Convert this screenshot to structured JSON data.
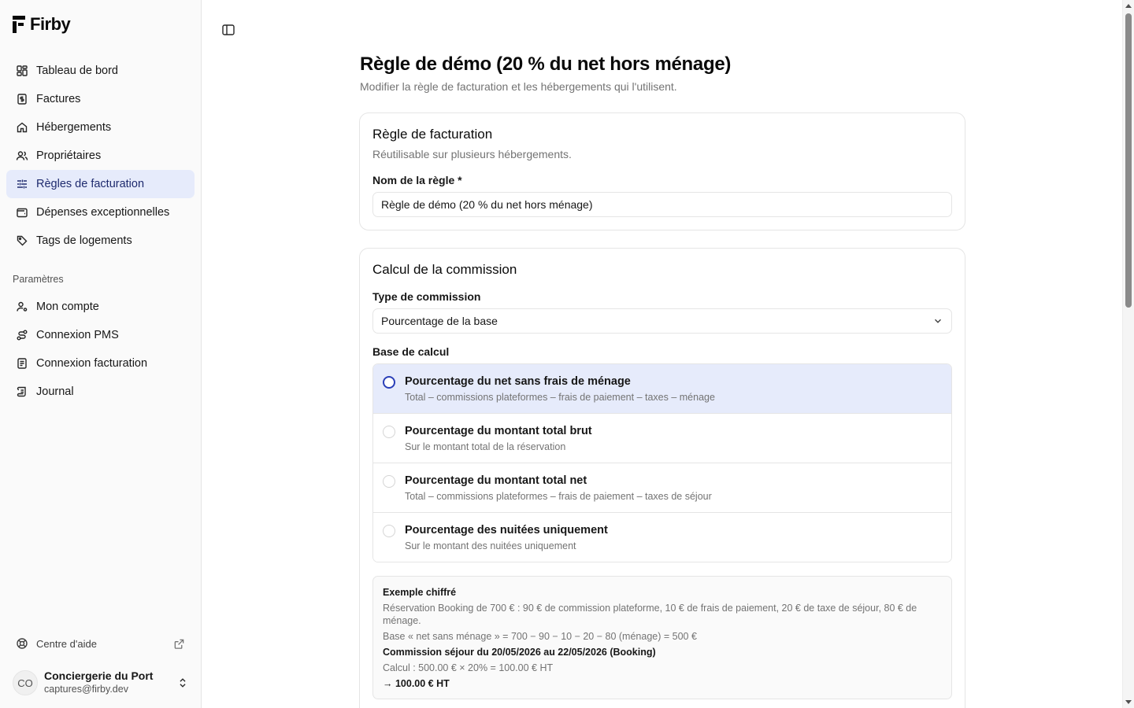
{
  "app": {
    "name": "Firby"
  },
  "sidebar": {
    "items": [
      {
        "label": "Tableau de bord",
        "icon": "dashboard-icon"
      },
      {
        "label": "Factures",
        "icon": "invoice-icon"
      },
      {
        "label": "Hébergements",
        "icon": "home-icon"
      },
      {
        "label": "Propriétaires",
        "icon": "users-icon"
      },
      {
        "label": "Règles de facturation",
        "icon": "sliders-icon",
        "active": true
      },
      {
        "label": "Dépenses exceptionnelles",
        "icon": "wallet-icon"
      },
      {
        "label": "Tags de logements",
        "icon": "tag-icon"
      }
    ],
    "settings_section": "Paramètres",
    "settings_items": [
      {
        "label": "Mon compte",
        "icon": "user-cog-icon"
      },
      {
        "label": "Connexion PMS",
        "icon": "route-icon"
      },
      {
        "label": "Connexion facturation",
        "icon": "file-text-icon"
      },
      {
        "label": "Journal",
        "icon": "scroll-icon"
      }
    ],
    "help": "Centre d'aide",
    "user": {
      "initials": "CO",
      "name": "Conciergerie du Port",
      "email": "captures@firby.dev"
    }
  },
  "page": {
    "title": "Règle de démo (20 % du net hors ménage)",
    "subtitle": "Modifier la règle de facturation et les hébergements qui l'utilisent."
  },
  "rule_card": {
    "title": "Règle de facturation",
    "description": "Réutilisable sur plusieurs hébergements.",
    "name_label": "Nom de la règle *",
    "name_value": "Règle de démo (20 % du net hors ménage)"
  },
  "commission_card": {
    "title": "Calcul de la commission",
    "type_label": "Type de commission",
    "type_value": "Pourcentage de la base",
    "base_label": "Base de calcul",
    "options": [
      {
        "title": "Pourcentage du net sans frais de ménage",
        "desc": "Total – commissions plateformes – frais de paiement – taxes – ménage",
        "selected": true
      },
      {
        "title": "Pourcentage du montant total brut",
        "desc": "Sur le montant total de la réservation",
        "selected": false
      },
      {
        "title": "Pourcentage du montant total net",
        "desc": "Total – commissions plateformes – frais de paiement – taxes de séjour",
        "selected": false
      },
      {
        "title": "Pourcentage des nuitées uniquement",
        "desc": "Sur le montant des nuitées uniquement",
        "selected": false
      }
    ],
    "example": {
      "title": "Exemple chiffré",
      "line1": "Réservation Booking de 700 € : 90 € de commission plateforme, 10 € de frais de paiement, 20 € de taxe de séjour, 80 € de ménage.",
      "line2": "Base « net sans ménage » = 700 − 90 − 10 − 20 − 80 (ménage) = 500 €",
      "stay": "Commission séjour du 20/05/2026 au 22/05/2026 (Booking)",
      "calc": "Calcul : 500.00 € × 20% = 100.00 € HT",
      "result": "→ 100.00 € HT"
    }
  },
  "colors": {
    "accent": "#2a3fb8",
    "active_bg": "#e6ebfb"
  }
}
